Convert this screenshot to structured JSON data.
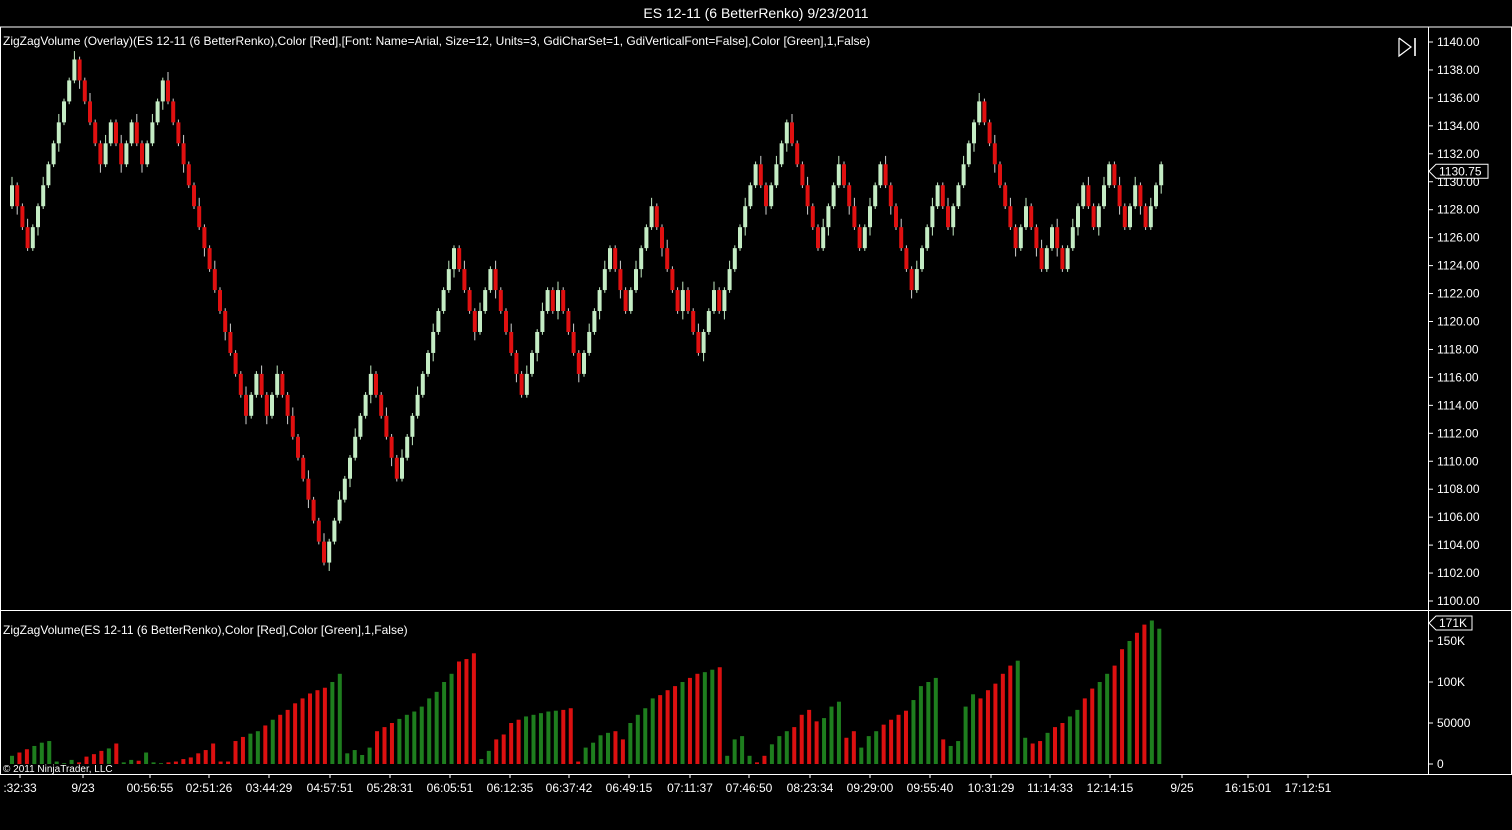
{
  "window_title": "ES 12-11 (6 BetterRenko)  9/23/2011",
  "price_panel": {
    "indicator_label": "ZigZagVolume (Overlay)(ES 12-11 (6 BetterRenko),Color [Red],[Font: Name=Arial, Size=12, Units=3, GdiCharSet=1, GdiVerticalFont=False],Color [Green],1,False)",
    "last_price_label": "1130.75",
    "y_tick_labels": [
      "1100.00",
      "1102.00",
      "1104.00",
      "1106.00",
      "1108.00",
      "1110.00",
      "1112.00",
      "1114.00",
      "1116.00",
      "1118.00",
      "1120.00",
      "1122.00",
      "1124.00",
      "1126.00",
      "1128.00",
      "1130.00",
      "1132.00",
      "1134.00",
      "1136.00",
      "1138.00",
      "1140.00"
    ]
  },
  "volume_panel": {
    "indicator_label": "ZigZagVolume(ES 12-11 (6 BetterRenko),Color [Red],Color [Green],1,False)",
    "last_volume_label": "171K",
    "y_tick_labels": [
      "0",
      "50000",
      "100K",
      "150K"
    ]
  },
  "x_axis_labels": [
    ":32:33",
    "9/23",
    "00:56:55",
    "02:51:26",
    "03:44:29",
    "04:57:51",
    "05:28:31",
    "06:05:51",
    "06:12:35",
    "06:37:42",
    "06:49:15",
    "07:11:37",
    "07:46:50",
    "08:23:34",
    "09:29:00",
    "09:55:40",
    "10:31:29",
    "11:14:33",
    "12:14:15",
    "9/25",
    "16:15:01",
    "17:12:51"
  ],
  "copyright": "© 2011 NinjaTrader, LLC",
  "colors": {
    "up": "#c4ecc4",
    "down": "#e01010",
    "vol_up": "#1e7e1e",
    "vol_down": "#dc1010",
    "background": "#000000",
    "axis": "#ffffff"
  },
  "icons": {
    "scroll_end": "skip-to-end-icon"
  },
  "chart_data": [
    {
      "type": "candlestick",
      "title": "",
      "ylim": [
        1100,
        1140
      ],
      "brick_size": 1.5,
      "x_tick_labels": [
        ":32:33",
        "9/23",
        "00:56:55",
        "02:51:26",
        "03:44:29",
        "04:57:51",
        "05:28:31",
        "06:05:51",
        "06:12:35",
        "06:37:42",
        "06:49:15",
        "07:11:37",
        "07:46:50",
        "08:23:34",
        "09:29:00",
        "09:55:40",
        "10:31:29",
        "11:14:33",
        "12:14:15",
        "9/25",
        "16:15:01",
        "17:12:51"
      ],
      "close": [
        1129.75,
        1128.25,
        1126.75,
        1125.25,
        1126.75,
        1128.25,
        1129.75,
        1131.25,
        1132.75,
        1134.25,
        1135.75,
        1137.25,
        1138.75,
        1137.25,
        1135.75,
        1134.25,
        1132.75,
        1131.25,
        1132.75,
        1134.25,
        1132.75,
        1131.25,
        1132.75,
        1134.25,
        1132.75,
        1131.25,
        1132.75,
        1134.25,
        1135.75,
        1137.25,
        1135.75,
        1134.25,
        1132.75,
        1131.25,
        1129.75,
        1128.25,
        1126.75,
        1125.25,
        1123.75,
        1122.25,
        1120.75,
        1119.25,
        1117.75,
        1116.25,
        1114.75,
        1113.25,
        1114.75,
        1116.25,
        1114.75,
        1113.25,
        1114.75,
        1116.25,
        1114.75,
        1113.25,
        1111.75,
        1110.25,
        1108.75,
        1107.25,
        1105.75,
        1104.25,
        1102.75,
        1104.25,
        1105.75,
        1107.25,
        1108.75,
        1110.25,
        1111.75,
        1113.25,
        1114.75,
        1116.25,
        1114.75,
        1113.25,
        1111.75,
        1110.25,
        1108.75,
        1110.25,
        1111.75,
        1113.25,
        1114.75,
        1116.25,
        1117.75,
        1119.25,
        1120.75,
        1122.25,
        1123.75,
        1125.25,
        1123.75,
        1122.25,
        1120.75,
        1119.25,
        1120.75,
        1122.25,
        1123.75,
        1122.25,
        1120.75,
        1119.25,
        1117.75,
        1116.25,
        1114.75,
        1116.25,
        1117.75,
        1119.25,
        1120.75,
        1122.25,
        1120.75,
        1122.25,
        1120.75,
        1119.25,
        1117.75,
        1116.25,
        1117.75,
        1119.25,
        1120.75,
        1122.25,
        1123.75,
        1125.25,
        1123.75,
        1122.25,
        1120.75,
        1122.25,
        1123.75,
        1125.25,
        1126.75,
        1128.25,
        1126.75,
        1125.25,
        1123.75,
        1122.25,
        1120.75,
        1122.25,
        1120.75,
        1119.25,
        1117.75,
        1119.25,
        1120.75,
        1122.25,
        1120.75,
        1122.25,
        1123.75,
        1125.25,
        1126.75,
        1128.25,
        1129.75,
        1131.25,
        1129.75,
        1128.25,
        1129.75,
        1131.25,
        1132.75,
        1134.25,
        1132.75,
        1131.25,
        1129.75,
        1128.25,
        1126.75,
        1125.25,
        1126.75,
        1128.25,
        1129.75,
        1131.25,
        1129.75,
        1128.25,
        1126.75,
        1125.25,
        1126.75,
        1128.25,
        1129.75,
        1131.25,
        1129.75,
        1128.25,
        1126.75,
        1125.25,
        1123.75,
        1122.25,
        1123.75,
        1125.25,
        1126.75,
        1128.25,
        1129.75,
        1128.25,
        1126.75,
        1128.25,
        1129.75,
        1131.25,
        1132.75,
        1134.25,
        1135.75,
        1134.25,
        1132.75,
        1131.25,
        1129.75,
        1128.25,
        1126.75,
        1125.25,
        1126.75,
        1128.25,
        1126.75,
        1125.25,
        1123.75,
        1125.25,
        1126.75,
        1125.25,
        1123.75,
        1125.25,
        1126.75,
        1128.25,
        1129.75,
        1128.25,
        1126.75,
        1128.25,
        1129.75,
        1131.25,
        1129.75,
        1128.25,
        1126.75,
        1128.25,
        1129.75,
        1128.25,
        1126.75,
        1128.25,
        1129.75,
        1131.25
      ]
    },
    {
      "type": "bar",
      "title": "",
      "ylim": [
        0,
        180000
      ],
      "series": [
        {
          "values": [
            10000,
            14000,
            18000,
            22000,
            26000,
            28000,
            3000,
            1000,
            5000,
            2000,
            9000,
            12000,
            16000,
            19000,
            25000,
            2000,
            5000,
            4000,
            14000,
            2000,
            1000,
            2000,
            3000,
            6000,
            8000,
            13000,
            17000,
            25000,
            3000,
            3000,
            28000,
            33000,
            37000,
            40000,
            47000,
            54000,
            60000,
            66000,
            74000,
            80000,
            86000,
            90000,
            93000,
            100000,
            110000,
            13000,
            17000,
            11000,
            20000,
            40000,
            45000,
            50000,
            55000,
            60000,
            64000,
            70000,
            80000,
            88000,
            100000,
            110000,
            125000,
            128000,
            135000,
            6000,
            16000,
            30000,
            36000,
            50000,
            54000,
            58000,
            60000,
            62000,
            64000,
            65000,
            66000,
            68000,
            3000,
            20000,
            26000,
            35000,
            38000,
            40000,
            30000,
            50000,
            60000,
            68000,
            80000,
            84000,
            90000,
            95000,
            100000,
            105000,
            110000,
            112000,
            115000,
            118000,
            10000,
            30000,
            34000,
            10000,
            2000,
            10000,
            24000,
            34000,
            40000,
            45000,
            60000,
            66000,
            52000,
            56000,
            70000,
            76000,
            32000,
            40000,
            20000,
            34000,
            40000,
            48000,
            54000,
            60000,
            65000,
            78000,
            95000,
            100000,
            105000,
            30000,
            22000,
            28000,
            70000,
            85000,
            80000,
            90000,
            98000,
            110000,
            120000,
            126000,
            32000,
            25000,
            28000,
            38000,
            45000,
            50000,
            58000,
            66000,
            80000,
            92000,
            100000,
            110000,
            120000,
            140000,
            150000,
            160000,
            170000,
            175000,
            165000
          ]
        }
      ]
    }
  ]
}
